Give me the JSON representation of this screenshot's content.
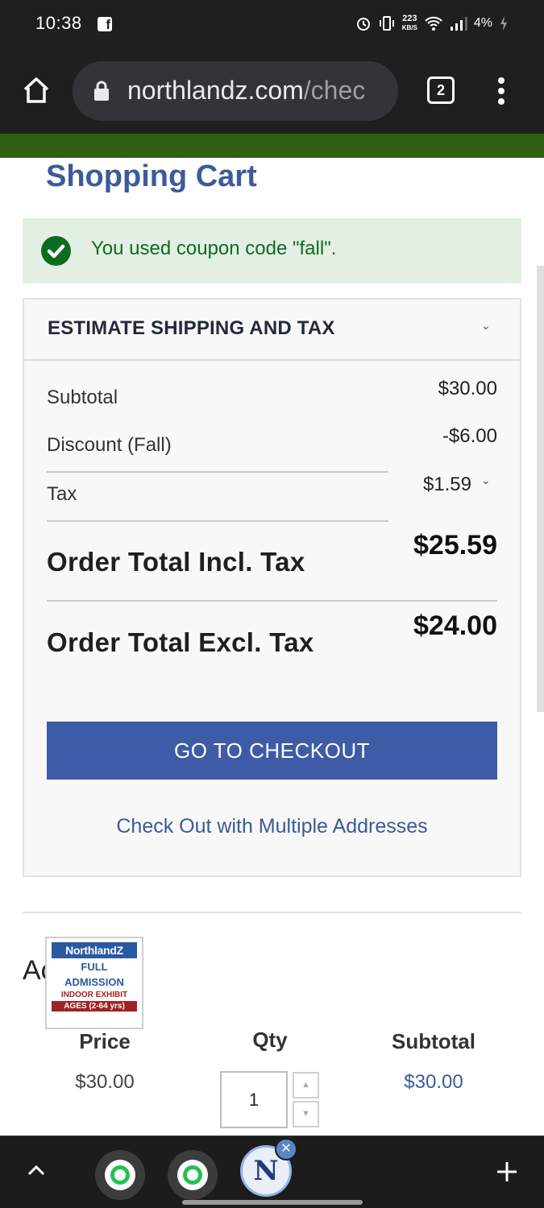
{
  "status_bar": {
    "time": "10:38",
    "net_speed_value": "223",
    "net_speed_unit": "KB/S",
    "battery": "4%"
  },
  "browser": {
    "url_host": "northlandz.com",
    "url_path": "/chec",
    "tab_count": "2"
  },
  "page": {
    "title": "Shopping Cart",
    "coupon_message": "You used coupon code \"fall\".",
    "estimate_label": "ESTIMATE SHIPPING AND TAX",
    "totals": {
      "subtotal_label": "Subtotal",
      "subtotal_value": "$30.00",
      "discount_label": "Discount (Fall)",
      "discount_value": "-$6.00",
      "tax_label": "Tax",
      "tax_value": "$1.59",
      "incl_label": "Order Total Incl. Tax",
      "incl_value": "$25.59",
      "excl_label": "Order Total Excl. Tax",
      "excl_value": "$24.00"
    },
    "checkout_button": "GO TO CHECKOUT",
    "multi_address_link": "Check Out with Multiple Addresses",
    "item": {
      "name_prefix": "Ac",
      "thumb_brand": "NorthlandZ",
      "thumb_line1": "FULL",
      "thumb_line2": "ADMISSION",
      "thumb_line3": "INDOOR EXHIBIT",
      "thumb_line4": "AGES (2-64 yrs)",
      "price_header": "Price",
      "qty_header": "Qty",
      "subtotal_header": "Subtotal",
      "price": "$30.00",
      "qty": "1",
      "subtotal": "$30.00"
    }
  },
  "colors": {
    "brand_blue": "#3d5ba7",
    "header_green": "#2f5f12",
    "success_green": "#0d6b20"
  }
}
